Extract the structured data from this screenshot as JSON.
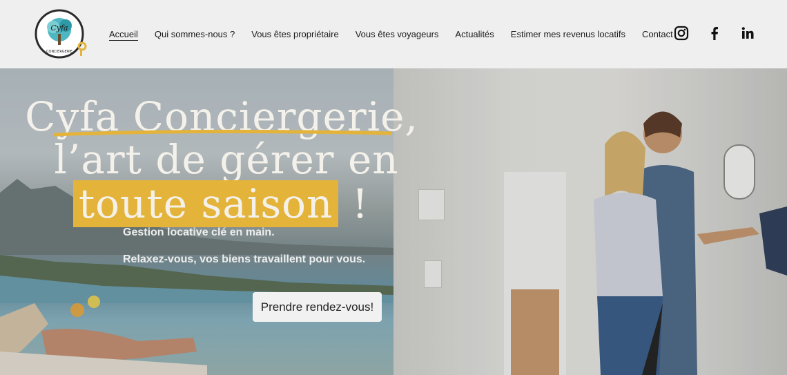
{
  "brand": {
    "logo_text": "Cyfa",
    "logo_subtext": "CONCIERGERIE"
  },
  "nav": {
    "items": [
      {
        "label": "Accueil"
      },
      {
        "label": "Qui sommes-nous ?"
      },
      {
        "label": "Vous êtes propriétaire"
      },
      {
        "label": "Vous êtes voyageurs"
      },
      {
        "label": "Actualités"
      },
      {
        "label": "Estimer mes revenus locatifs"
      },
      {
        "label": "Contact"
      }
    ]
  },
  "social": {
    "icons": [
      "instagram-icon",
      "facebook-icon",
      "linkedin-icon"
    ]
  },
  "hero": {
    "title_line1": "Cyfa Conciergerie,",
    "title_line2": "l’art de gérer en",
    "title_line3_highlight": "toute saison",
    "title_line3_end": "!",
    "subtitle1": "Gestion locative clé en main.",
    "subtitle2": "Relaxez-vous, vos biens travaillent pour vous.",
    "cta_label": "Prendre rendez-vous!"
  },
  "colors": {
    "accent": "#e4b33a",
    "header_bg": "#efefef",
    "text": "#1a1a1a"
  }
}
